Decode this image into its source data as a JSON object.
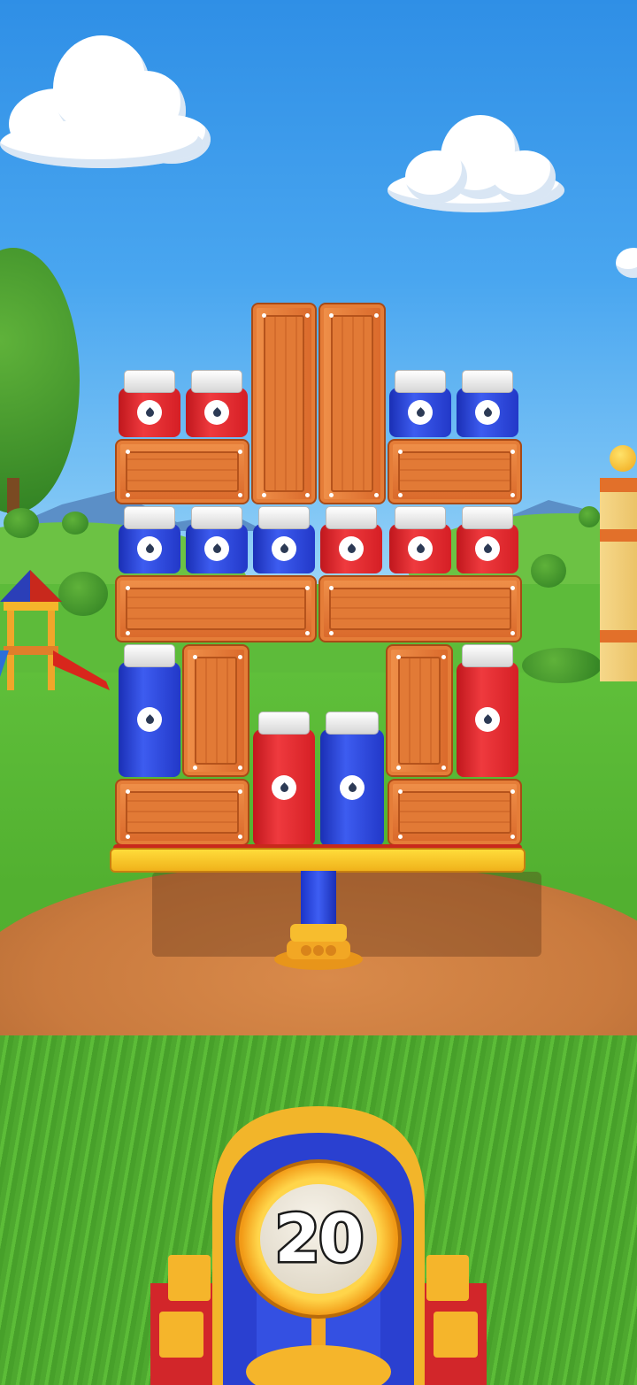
{
  "game": {
    "shots_remaining": "20"
  },
  "colors": {
    "red_bottle": "#e1262c",
    "blue_bottle": "#2c46dc",
    "crate": "#e57d38",
    "platform": "#f7c42a",
    "cannon_blue": "#2a40d0",
    "cannon_gold": "#f4a71c"
  },
  "icons": {
    "bottle_mark": "water-drop-icon",
    "counter": "ammo-counter"
  }
}
